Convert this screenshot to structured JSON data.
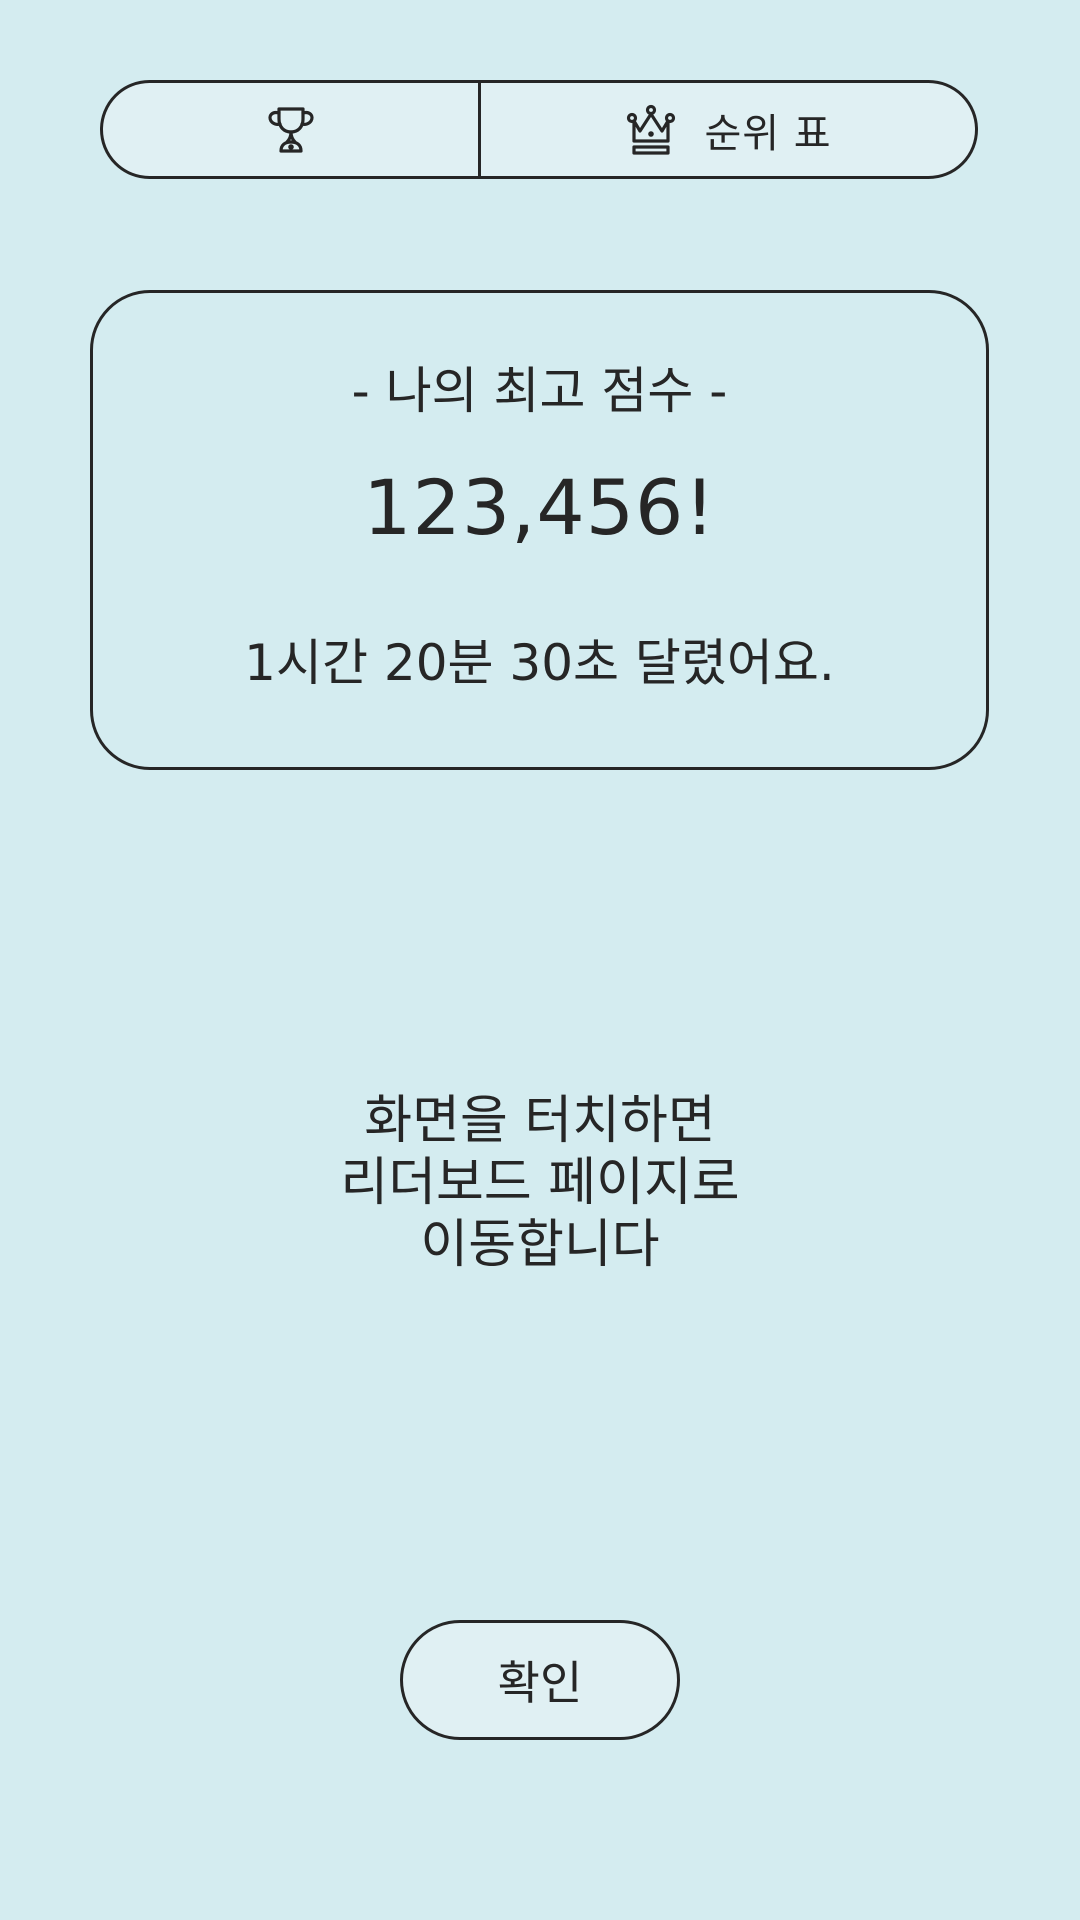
{
  "tabs": [
    {
      "icon": "trophy-icon",
      "label": ""
    },
    {
      "icon": "crown-icon",
      "label": "순위 표"
    }
  ],
  "score_card": {
    "title": "- 나의 최고 점수 -",
    "score": "123,456!",
    "time": "1시간 20분 30초 달렸어요."
  },
  "instruction": {
    "lines": [
      "화면을 터치하면",
      "리더보드 페이지로",
      "이동합니다"
    ]
  },
  "confirm_button": {
    "label": "확인"
  },
  "colors": {
    "background": "#d4ecf0",
    "surface": "#e0f0f3",
    "ink": "#262626"
  }
}
